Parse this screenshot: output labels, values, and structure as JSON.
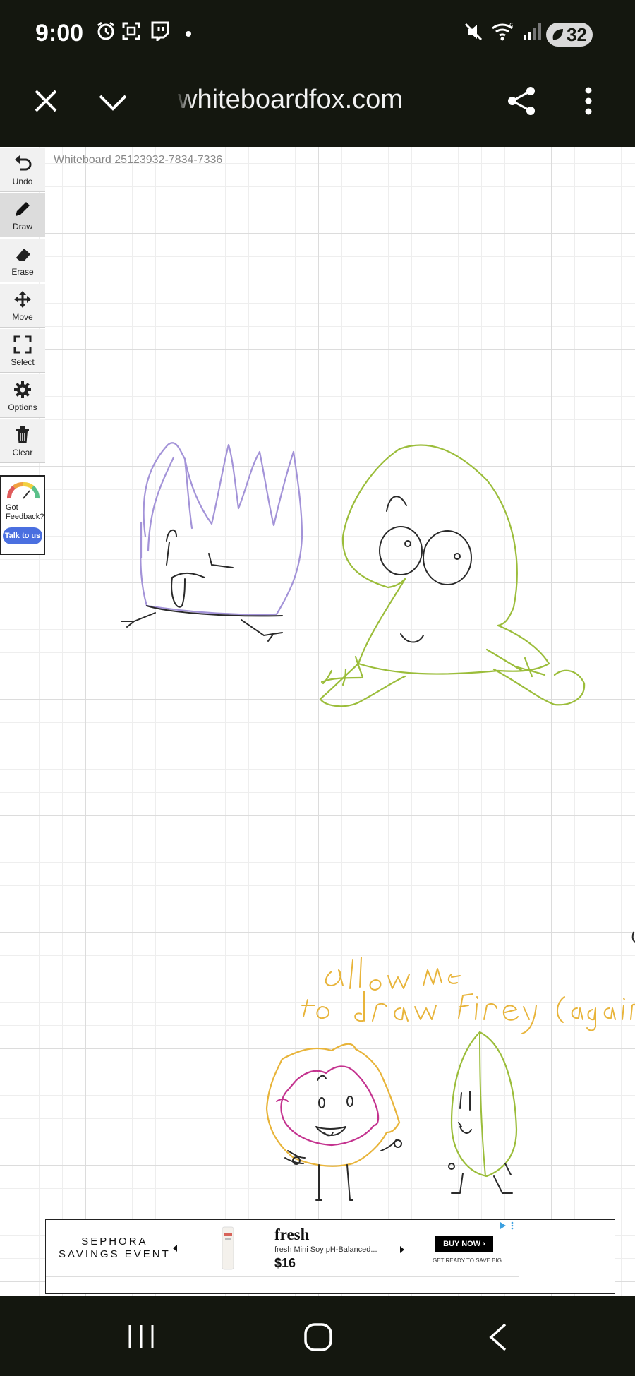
{
  "status_bar": {
    "time": "9:00",
    "battery_level": "32",
    "icons": [
      "alarm-icon",
      "screenshot-icon",
      "twitch-icon",
      "notification-dot-icon",
      "mute-icon",
      "wifi-icon",
      "signal-icon",
      "battery-icon"
    ]
  },
  "browser": {
    "url": "whiteboardfox.com",
    "close_icon": "close-icon",
    "dropdown_icon": "chevron-down-icon",
    "share_icon": "share-icon",
    "menu_icon": "more-vert-icon"
  },
  "whiteboard": {
    "title": "Whiteboard 25123932-7834-7336",
    "handwritten_note": "allow me to draw Firey (again)"
  },
  "toolbar": {
    "tools": [
      {
        "label": "Undo",
        "icon": "undo-icon"
      },
      {
        "label": "Draw",
        "icon": "pencil-icon",
        "active": true
      },
      {
        "label": "Erase",
        "icon": "eraser-icon"
      },
      {
        "label": "Move",
        "icon": "move-icon"
      },
      {
        "label": "Select",
        "icon": "select-icon"
      },
      {
        "label": "Options",
        "icon": "gear-icon"
      },
      {
        "label": "Clear",
        "icon": "trash-icon"
      }
    ],
    "feedback": {
      "text_line1": "Got",
      "text_line2": "Feedback?",
      "button": "Talk to us",
      "icon": "gauge-icon"
    }
  },
  "ad": {
    "brand_line1": "SEPHORA",
    "brand_line2": "SAVINGS EVENT",
    "product_title": "fresh",
    "product_desc": "fresh Mini Soy pH-Balanced...",
    "price": "$16",
    "cta": "BUY NOW ›",
    "tagline": "GET READY TO SAVE BIG"
  },
  "nav_bar": {
    "icons": [
      "recents-icon",
      "home-icon",
      "back-icon"
    ]
  },
  "colors": {
    "system_bar": "#14170f",
    "accent_blue": "#4a6fe0",
    "ink_purple": "#a393d8",
    "ink_green": "#9bbd3a",
    "ink_orange": "#e8b43a",
    "ink_magenta": "#c4338f",
    "ink_black": "#2a2a2a"
  }
}
